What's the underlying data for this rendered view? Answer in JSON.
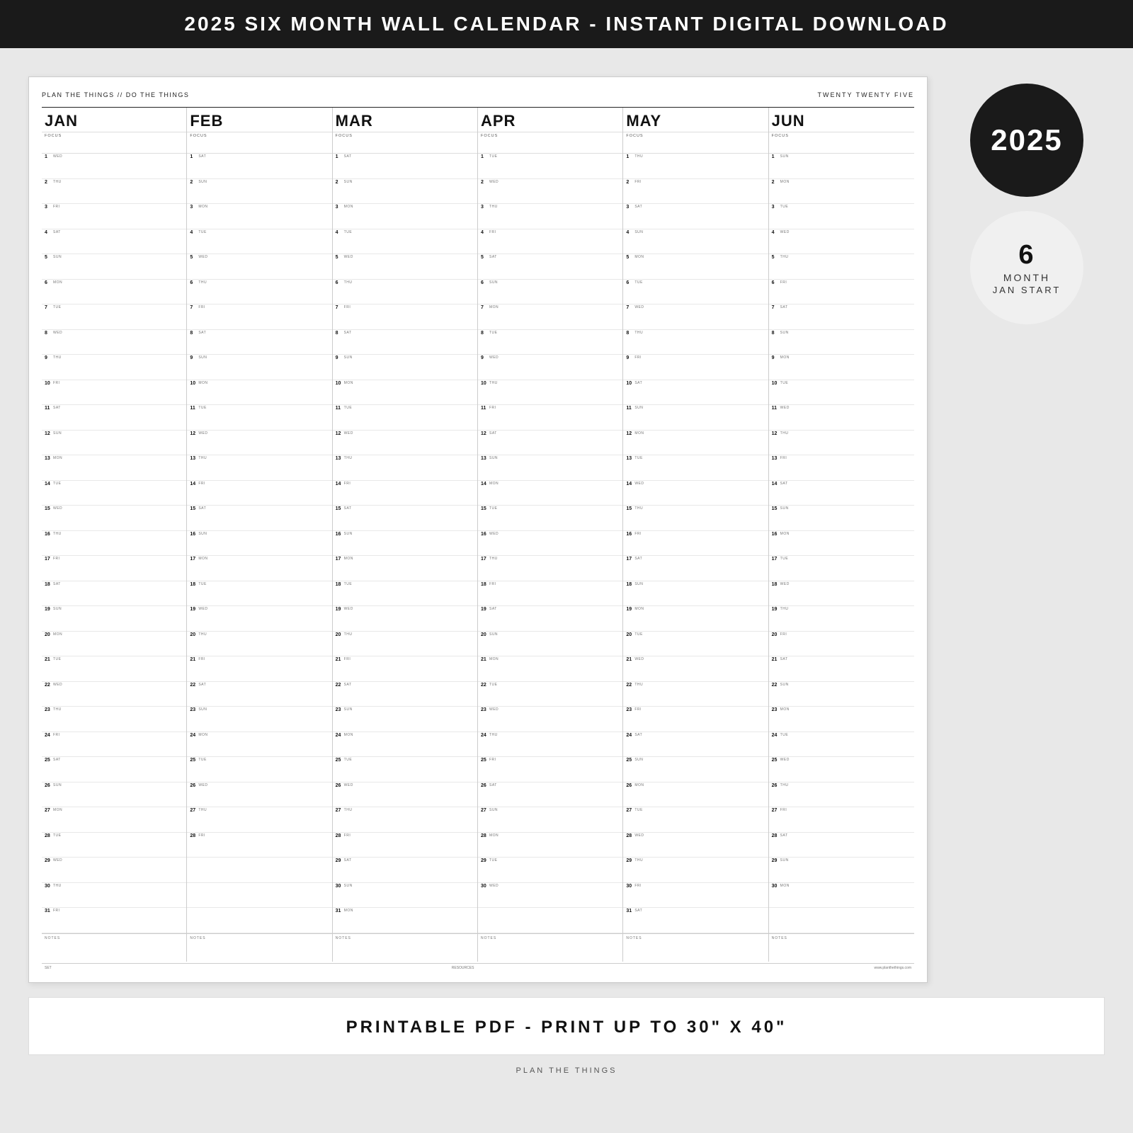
{
  "top_banner": {
    "text": "2025 SIX MONTH WALL CALENDAR - INSTANT DIGITAL DOWNLOAD"
  },
  "calendar": {
    "header_left": "PLAN THE THINGS // DO THE THINGS",
    "header_right": "TWENTY TWENTY FIVE",
    "months": [
      {
        "name": "JAN",
        "focus_label": "FOCUS",
        "days": [
          {
            "num": "1",
            "day": "WED"
          },
          {
            "num": "2",
            "day": "THU"
          },
          {
            "num": "3",
            "day": "FRI"
          },
          {
            "num": "4",
            "day": "SAT"
          },
          {
            "num": "5",
            "day": "SUN"
          },
          {
            "num": "6",
            "day": "MON"
          },
          {
            "num": "7",
            "day": "TUE"
          },
          {
            "num": "8",
            "day": "WED"
          },
          {
            "num": "9",
            "day": "THU"
          },
          {
            "num": "10",
            "day": "FRI"
          },
          {
            "num": "11",
            "day": "SAT"
          },
          {
            "num": "12",
            "day": "SUN"
          },
          {
            "num": "13",
            "day": "MON"
          },
          {
            "num": "14",
            "day": "TUE"
          },
          {
            "num": "15",
            "day": "WED"
          },
          {
            "num": "16",
            "day": "THU"
          },
          {
            "num": "17",
            "day": "FRI"
          },
          {
            "num": "18",
            "day": "SAT"
          },
          {
            "num": "19",
            "day": "SUN"
          },
          {
            "num": "20",
            "day": "MON"
          },
          {
            "num": "21",
            "day": "TUE"
          },
          {
            "num": "22",
            "day": "WED"
          },
          {
            "num": "23",
            "day": "THU"
          },
          {
            "num": "24",
            "day": "FRI"
          },
          {
            "num": "25",
            "day": "SAT"
          },
          {
            "num": "26",
            "day": "SUN"
          },
          {
            "num": "27",
            "day": "MON"
          },
          {
            "num": "28",
            "day": "TUE"
          },
          {
            "num": "29",
            "day": "WED"
          },
          {
            "num": "30",
            "day": "THU"
          },
          {
            "num": "31",
            "day": "FRI"
          }
        ]
      },
      {
        "name": "FEB",
        "focus_label": "FOCUS",
        "days": [
          {
            "num": "1",
            "day": "SAT"
          },
          {
            "num": "2",
            "day": "SUN"
          },
          {
            "num": "3",
            "day": "MON"
          },
          {
            "num": "4",
            "day": "TUE"
          },
          {
            "num": "5",
            "day": "WED"
          },
          {
            "num": "6",
            "day": "THU"
          },
          {
            "num": "7",
            "day": "FRI"
          },
          {
            "num": "8",
            "day": "SAT"
          },
          {
            "num": "9",
            "day": "SUN"
          },
          {
            "num": "10",
            "day": "MON"
          },
          {
            "num": "11",
            "day": "TUE"
          },
          {
            "num": "12",
            "day": "WED"
          },
          {
            "num": "13",
            "day": "THU"
          },
          {
            "num": "14",
            "day": "FRI"
          },
          {
            "num": "15",
            "day": "SAT"
          },
          {
            "num": "16",
            "day": "SUN"
          },
          {
            "num": "17",
            "day": "MON"
          },
          {
            "num": "18",
            "day": "TUE"
          },
          {
            "num": "19",
            "day": "WED"
          },
          {
            "num": "20",
            "day": "THU"
          },
          {
            "num": "21",
            "day": "FRI"
          },
          {
            "num": "22",
            "day": "SAT"
          },
          {
            "num": "23",
            "day": "SUN"
          },
          {
            "num": "24",
            "day": "MON"
          },
          {
            "num": "25",
            "day": "TUE"
          },
          {
            "num": "26",
            "day": "WED"
          },
          {
            "num": "27",
            "day": "THU"
          },
          {
            "num": "28",
            "day": "FRI"
          }
        ]
      },
      {
        "name": "MAR",
        "focus_label": "FOCUS",
        "days": [
          {
            "num": "1",
            "day": "SAT"
          },
          {
            "num": "2",
            "day": "SUN"
          },
          {
            "num": "3",
            "day": "MON"
          },
          {
            "num": "4",
            "day": "TUE"
          },
          {
            "num": "5",
            "day": "WED"
          },
          {
            "num": "6",
            "day": "THU"
          },
          {
            "num": "7",
            "day": "FRI"
          },
          {
            "num": "8",
            "day": "SAT"
          },
          {
            "num": "9",
            "day": "SUN"
          },
          {
            "num": "10",
            "day": "MON"
          },
          {
            "num": "11",
            "day": "TUE"
          },
          {
            "num": "12",
            "day": "WED"
          },
          {
            "num": "13",
            "day": "THU"
          },
          {
            "num": "14",
            "day": "FRI"
          },
          {
            "num": "15",
            "day": "SAT"
          },
          {
            "num": "16",
            "day": "SUN"
          },
          {
            "num": "17",
            "day": "MON"
          },
          {
            "num": "18",
            "day": "TUE"
          },
          {
            "num": "19",
            "day": "WED"
          },
          {
            "num": "20",
            "day": "THU"
          },
          {
            "num": "21",
            "day": "FRI"
          },
          {
            "num": "22",
            "day": "SAT"
          },
          {
            "num": "23",
            "day": "SUN"
          },
          {
            "num": "24",
            "day": "MON"
          },
          {
            "num": "25",
            "day": "TUE"
          },
          {
            "num": "26",
            "day": "WED"
          },
          {
            "num": "27",
            "day": "THU"
          },
          {
            "num": "28",
            "day": "FRI"
          },
          {
            "num": "29",
            "day": "SAT"
          },
          {
            "num": "30",
            "day": "SUN"
          },
          {
            "num": "31",
            "day": "MON"
          }
        ]
      },
      {
        "name": "APR",
        "focus_label": "FOCUS",
        "days": [
          {
            "num": "1",
            "day": "TUE"
          },
          {
            "num": "2",
            "day": "WED"
          },
          {
            "num": "3",
            "day": "THU"
          },
          {
            "num": "4",
            "day": "FRI"
          },
          {
            "num": "5",
            "day": "SAT"
          },
          {
            "num": "6",
            "day": "SUN"
          },
          {
            "num": "7",
            "day": "MON"
          },
          {
            "num": "8",
            "day": "TUE"
          },
          {
            "num": "9",
            "day": "WED"
          },
          {
            "num": "10",
            "day": "THU"
          },
          {
            "num": "11",
            "day": "FRI"
          },
          {
            "num": "12",
            "day": "SAT"
          },
          {
            "num": "13",
            "day": "SUN"
          },
          {
            "num": "14",
            "day": "MON"
          },
          {
            "num": "15",
            "day": "TUE"
          },
          {
            "num": "16",
            "day": "WED"
          },
          {
            "num": "17",
            "day": "THU"
          },
          {
            "num": "18",
            "day": "FRI"
          },
          {
            "num": "19",
            "day": "SAT"
          },
          {
            "num": "20",
            "day": "SUN"
          },
          {
            "num": "21",
            "day": "MON"
          },
          {
            "num": "22",
            "day": "TUE"
          },
          {
            "num": "23",
            "day": "WED"
          },
          {
            "num": "24",
            "day": "THU"
          },
          {
            "num": "25",
            "day": "FRI"
          },
          {
            "num": "26",
            "day": "SAT"
          },
          {
            "num": "27",
            "day": "SUN"
          },
          {
            "num": "28",
            "day": "MON"
          },
          {
            "num": "29",
            "day": "TUE"
          },
          {
            "num": "30",
            "day": "WED"
          }
        ]
      },
      {
        "name": "MAY",
        "focus_label": "FOCUS",
        "days": [
          {
            "num": "1",
            "day": "THU"
          },
          {
            "num": "2",
            "day": "FRI"
          },
          {
            "num": "3",
            "day": "SAT"
          },
          {
            "num": "4",
            "day": "SUN"
          },
          {
            "num": "5",
            "day": "MON"
          },
          {
            "num": "6",
            "day": "TUE"
          },
          {
            "num": "7",
            "day": "WED"
          },
          {
            "num": "8",
            "day": "THU"
          },
          {
            "num": "9",
            "day": "FRI"
          },
          {
            "num": "10",
            "day": "SAT"
          },
          {
            "num": "11",
            "day": "SUN"
          },
          {
            "num": "12",
            "day": "MON"
          },
          {
            "num": "13",
            "day": "TUE"
          },
          {
            "num": "14",
            "day": "WED"
          },
          {
            "num": "15",
            "day": "THU"
          },
          {
            "num": "16",
            "day": "FRI"
          },
          {
            "num": "17",
            "day": "SAT"
          },
          {
            "num": "18",
            "day": "SUN"
          },
          {
            "num": "19",
            "day": "MON"
          },
          {
            "num": "20",
            "day": "TUE"
          },
          {
            "num": "21",
            "day": "WED"
          },
          {
            "num": "22",
            "day": "THU"
          },
          {
            "num": "23",
            "day": "FRI"
          },
          {
            "num": "24",
            "day": "SAT"
          },
          {
            "num": "25",
            "day": "SUN"
          },
          {
            "num": "26",
            "day": "MON"
          },
          {
            "num": "27",
            "day": "TUE"
          },
          {
            "num": "28",
            "day": "WED"
          },
          {
            "num": "29",
            "day": "THU"
          },
          {
            "num": "30",
            "day": "FRI"
          },
          {
            "num": "31",
            "day": "SAT"
          }
        ]
      },
      {
        "name": "JUN",
        "focus_label": "FOCUS",
        "days": [
          {
            "num": "1",
            "day": "SUN"
          },
          {
            "num": "2",
            "day": "MON"
          },
          {
            "num": "3",
            "day": "TUE"
          },
          {
            "num": "4",
            "day": "WED"
          },
          {
            "num": "5",
            "day": "THU"
          },
          {
            "num": "6",
            "day": "FRI"
          },
          {
            "num": "7",
            "day": "SAT"
          },
          {
            "num": "8",
            "day": "SUN"
          },
          {
            "num": "9",
            "day": "MON"
          },
          {
            "num": "10",
            "day": "TUE"
          },
          {
            "num": "11",
            "day": "WED"
          },
          {
            "num": "12",
            "day": "THU"
          },
          {
            "num": "13",
            "day": "FRI"
          },
          {
            "num": "14",
            "day": "SAT"
          },
          {
            "num": "15",
            "day": "SUN"
          },
          {
            "num": "16",
            "day": "MON"
          },
          {
            "num": "17",
            "day": "TUE"
          },
          {
            "num": "18",
            "day": "WED"
          },
          {
            "num": "19",
            "day": "THU"
          },
          {
            "num": "20",
            "day": "FRI"
          },
          {
            "num": "21",
            "day": "SAT"
          },
          {
            "num": "22",
            "day": "SUN"
          },
          {
            "num": "23",
            "day": "MON"
          },
          {
            "num": "24",
            "day": "TUE"
          },
          {
            "num": "25",
            "day": "WED"
          },
          {
            "num": "26",
            "day": "THU"
          },
          {
            "num": "27",
            "day": "FRI"
          },
          {
            "num": "28",
            "day": "SAT"
          },
          {
            "num": "29",
            "day": "SUN"
          },
          {
            "num": "30",
            "day": "MON"
          }
        ]
      }
    ],
    "notes_label": "NOTES",
    "set_label": "SET",
    "resources_label": "RESOURCES",
    "website": "www.planthethings.com"
  },
  "sidebar": {
    "year": "2025",
    "months_num": "6",
    "month_label": "MONTH",
    "start_label": "JAN START"
  },
  "bottom_banner": {
    "text": "PRINTABLE PDF - PRINT UP TO 30\" x 40\""
  },
  "footer": {
    "text": "PLAN THE THINGS"
  }
}
